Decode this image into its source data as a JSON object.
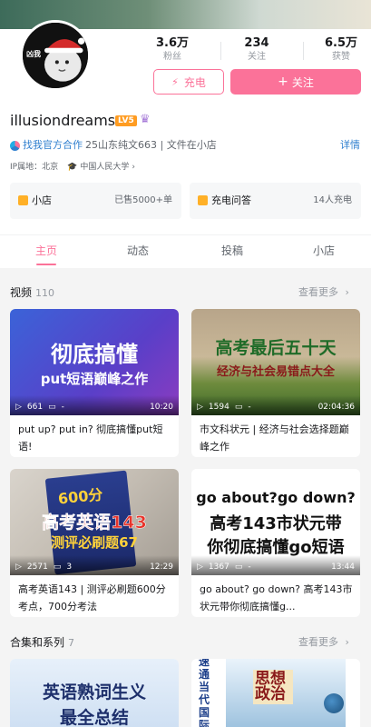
{
  "profile": {
    "avatar_text": "凶我",
    "stats": [
      {
        "value": "3.6万",
        "label": "粉丝"
      },
      {
        "value": "234",
        "label": "关注"
      },
      {
        "value": "6.5万",
        "label": "获赞"
      }
    ],
    "charge_label": "充电",
    "follow_label": "关注",
    "username": "illusiondreams",
    "level": "LV5",
    "partner_text": "找我官方合作",
    "signature": "25山东纯文663 | 文件在小店",
    "detail_link": "详情",
    "ip_location": "IP属地：北京",
    "school": "中国人民大学"
  },
  "cards": [
    {
      "name": "小店",
      "meta": "已售5000+单"
    },
    {
      "name": "充电问答",
      "meta": "14人充电"
    }
  ],
  "tabs": [
    "主页",
    "动态",
    "投稿",
    "小店"
  ],
  "videos_section": {
    "title": "视频",
    "count": "110",
    "more": "查看更多"
  },
  "videos": [
    {
      "thumb_line1": "彻底搞懂",
      "thumb_line2": "put短语巅峰之作",
      "views": "661",
      "comments": "-",
      "duration": "10:20",
      "title": "put up? put in? 彻底搞懂put短语!"
    },
    {
      "thumb_line1": "高考最后五十天",
      "thumb_line2": "经济与社会易错点大全",
      "views": "1594",
      "comments": "-",
      "duration": "02:04:36",
      "title": "市文科状元 | 经济与社会选择题巅峰之作"
    },
    {
      "thumb_line1": "高考英语143",
      "thumb_line2": "测评必刷题67",
      "book_text": "600分",
      "views": "2571",
      "comments": "3",
      "duration": "12:29",
      "title": "高考英语143 | 测评必刷题600分考点，700分考法"
    },
    {
      "thumb_line1": "go about?go down?",
      "thumb_line2": "高考143市状元带",
      "thumb_line3": "你彻底搞懂go短语",
      "views": "1367",
      "comments": "-",
      "duration": "13:44",
      "title": "go about? go down? 高考143市状元带你彻底搞懂g..."
    }
  ],
  "series_section": {
    "title": "合集和系列",
    "count": "7",
    "more": "查看更多"
  },
  "series": [
    {
      "thumb_line1": "英语熟词生义",
      "thumb_line2": "最全总结"
    },
    {
      "thumb_left": "速通当代国际政",
      "thumb_book": "思想政治"
    }
  ],
  "colors": {
    "accent": "#fb7299",
    "link": "#2f7fcf",
    "level": "#ff9c21"
  }
}
